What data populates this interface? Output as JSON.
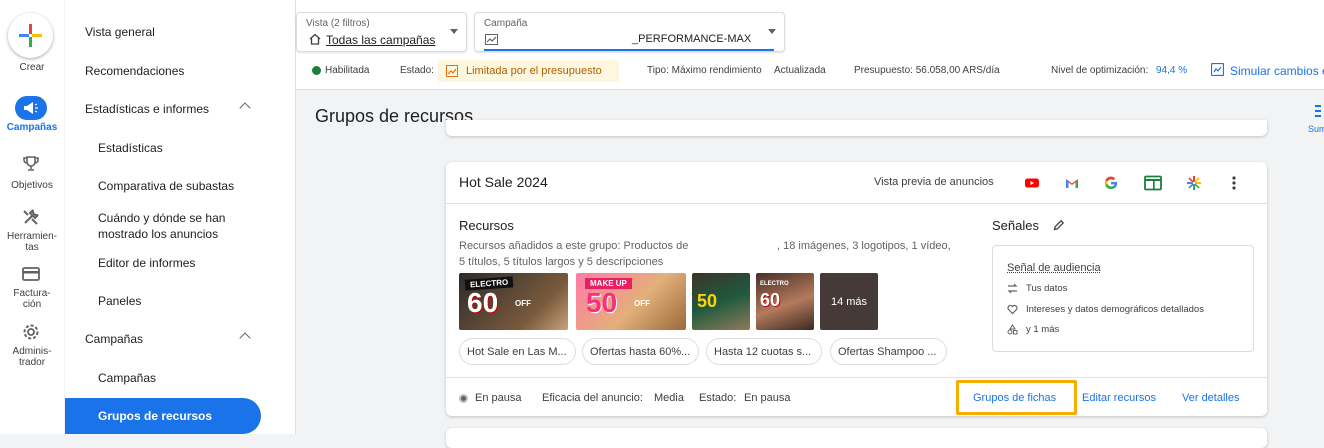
{
  "rail": {
    "create": "Crear",
    "items": [
      {
        "label": "Campañas"
      },
      {
        "label": "Objetivos"
      },
      {
        "label_lines": [
          "Herramien-",
          "tas"
        ]
      },
      {
        "label_lines": [
          "Factura-",
          "ción"
        ]
      },
      {
        "label_lines": [
          "Adminis-",
          "trador"
        ]
      }
    ]
  },
  "sidebar": {
    "items": [
      "Vista general",
      "Recomendaciones",
      "Estadísticas e informes",
      "Estadísticas",
      "Comparativa de subastas",
      "Cuándo y dónde se han",
      "mostrado los anuncios",
      "Editor de informes",
      "Paneles",
      "Campañas",
      "Campañas",
      "Grupos de recursos"
    ]
  },
  "topbar": {
    "view_caption": "Vista (2 filtros)",
    "view_value": "Todas las campañas",
    "campaign_caption": "Campaña",
    "campaign_value": "_PERFORMANCE-MAX",
    "status": "Habilitada",
    "estado_label": "Estado:",
    "estado_value": "Limitada por el presupuesto",
    "tipo": "Tipo: Máximo rendimiento",
    "actualizada": "Actualizada",
    "presupuesto": "Presupuesto: 56.058,00 ARS/día",
    "optim_label": "Nivel de optimización:",
    "optim_value": "94,4 %",
    "simular": "Simular cambios e",
    "right_cut": "Sum"
  },
  "page_title": "Grupos de recursos",
  "card": {
    "title": "Hot Sale 2024",
    "preview_label": "Vista previa de anuncios",
    "recursos_title": "Recursos",
    "recursos_desc_1a": "Recursos añadidos a este grupo: Productos de",
    "recursos_desc_1b": ", 18 imágenes, 3 logotipos, 1 vídeo,",
    "recursos_desc_2": "5 títulos, 5 títulos largos y 5 descripciones",
    "thumbs": [
      {
        "top": "ELECTRO",
        "big": "60",
        "suffix": "OFF"
      },
      {
        "top": "MAKE UP",
        "big": "50",
        "suffix": "OFF"
      },
      {
        "top": "",
        "big": "50",
        "suffix": ""
      },
      {
        "top": "ELECTRO",
        "big": "60",
        "suffix": ""
      }
    ],
    "more": "14 más",
    "chips": [
      "Hot Sale en Las M...",
      "Ofertas hasta 60%...",
      "Hasta 12 cuotas s...",
      "Ofertas Shampoo ..."
    ],
    "signals_title": "Señales",
    "signal_audience": "Señal de audiencia",
    "signal_rows": [
      "Tus datos",
      "Intereses y datos demográficos detallados",
      "y 1 más"
    ],
    "footer": {
      "status": "En pausa",
      "eficacia_label": "Eficacia del anuncio:",
      "eficacia_value": "Media",
      "estado_label": "Estado:",
      "estado_value": "En pausa",
      "grupos_fichas": "Grupos de fichas",
      "editar": "Editar recursos",
      "ver": "Ver detalles"
    }
  },
  "colors": {
    "accent": "#1a73e8",
    "highlight_box": "#f9ab00",
    "status_green": "#188038",
    "warning_bg": "#fef7e0",
    "warning_text": "#b06000"
  }
}
